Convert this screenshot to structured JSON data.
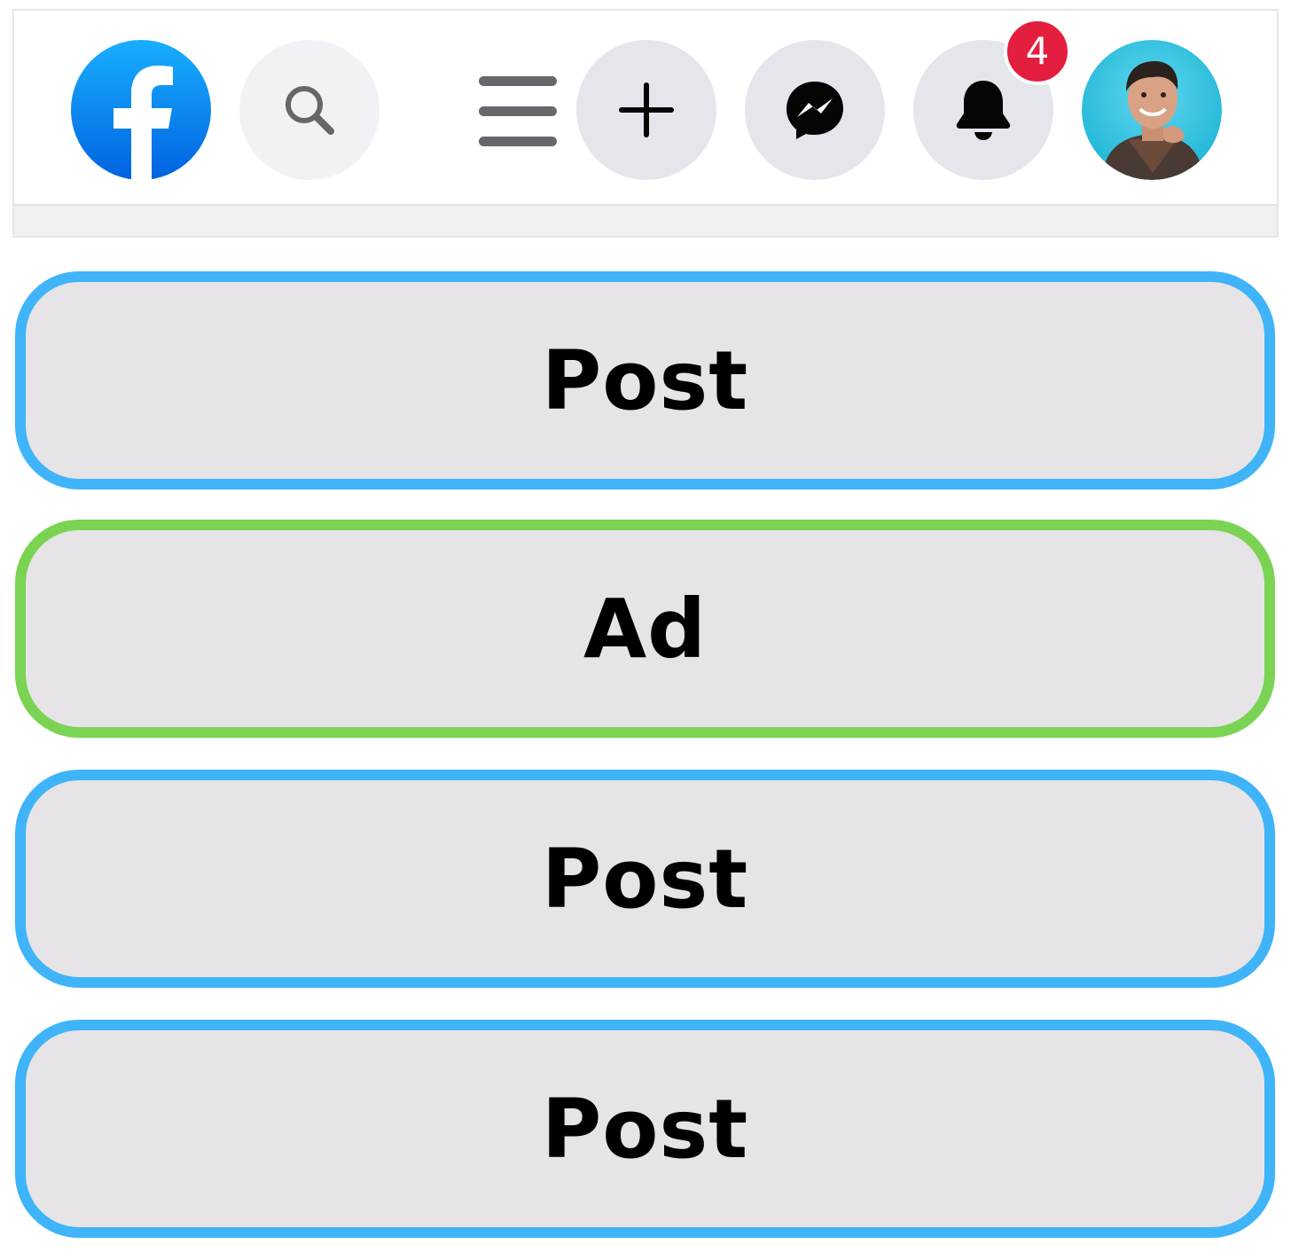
{
  "navbar": {
    "logo": {
      "icon": "facebook-f-icon",
      "color": "#1877f2"
    },
    "search": {
      "icon": "search-icon",
      "background": "#f0f2f5",
      "icon_color": "#65676b"
    },
    "menu": {
      "icon": "hamburger-menu-icon",
      "color": "#65676b"
    },
    "create": {
      "icon": "plus-icon",
      "background": "#e4e6eb"
    },
    "messenger": {
      "icon": "messenger-icon",
      "background": "#e4e6eb"
    },
    "notifications": {
      "icon": "bell-icon",
      "background": "#e4e6eb",
      "badge_count": "4",
      "badge_color": "#e41e3f"
    },
    "profile": {
      "icon": "avatar-photo-icon"
    }
  },
  "feed": {
    "items": [
      {
        "label": "Post",
        "type": "post",
        "border_color": "#3fb4f9"
      },
      {
        "label": "Ad",
        "type": "ad",
        "border_color": "#7ad352"
      },
      {
        "label": "Post",
        "type": "post",
        "border_color": "#3fb4f9"
      },
      {
        "label": "Post",
        "type": "post",
        "border_color": "#3fb4f9"
      }
    ],
    "card_background": "#e6e4e6"
  }
}
